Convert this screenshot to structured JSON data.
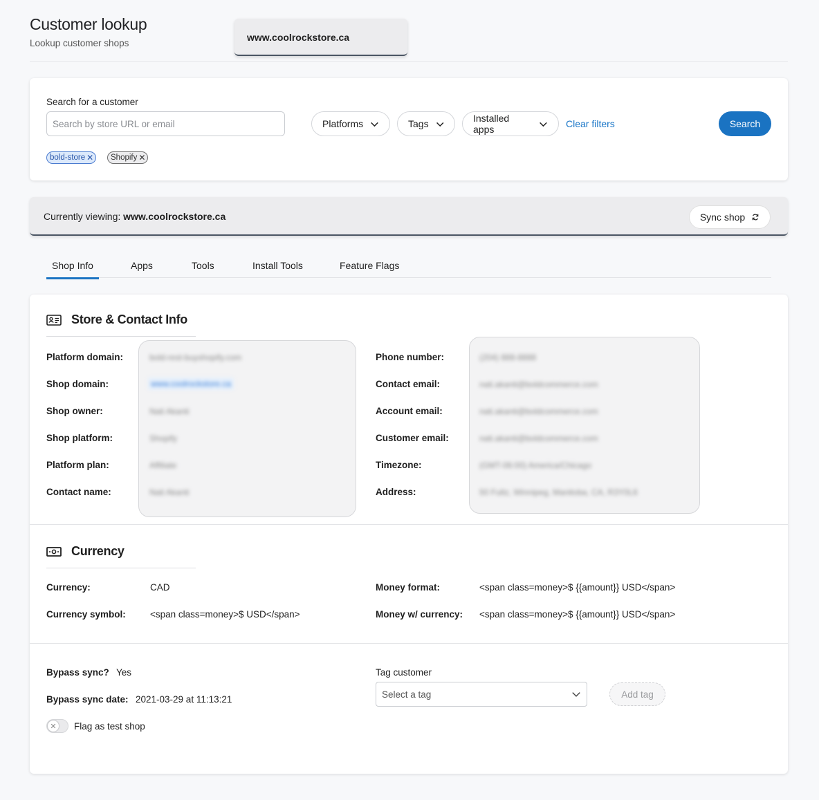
{
  "header": {
    "title": "Customer lookup",
    "subtitle": "Lookup customer shops",
    "current_shop": "www.coolrockstore.ca"
  },
  "search": {
    "label": "Search for a customer",
    "placeholder": "Search by store URL or email",
    "filters": [
      "Platforms",
      "Tags",
      "Installed apps"
    ],
    "clear_filters": "Clear filters",
    "search_button": "Search",
    "active_tags": [
      "bold-store",
      "Shopify"
    ]
  },
  "viewing": {
    "prefix": "Currently viewing:",
    "shop": "www.coolrockstore.ca",
    "sync_button": "Sync shop"
  },
  "tabs": [
    "Shop Info",
    "Apps",
    "Tools",
    "Install Tools",
    "Feature Flags"
  ],
  "store_contact": {
    "title": "Store & Contact Info",
    "left_labels": [
      "Platform domain:",
      "Shop domain:",
      "Shop owner:",
      "Shop platform:",
      "Platform plan:",
      "Contact name:"
    ],
    "left_values": [
      "bold-rest-buyshopify.com",
      "www.coolrockstore.ca",
      "Nati Akanti",
      "Shopify",
      "Affiliate",
      "Nati Akanti"
    ],
    "right_labels": [
      "Phone number:",
      "Contact email:",
      "Account email:",
      "Customer email:",
      "Timezone:",
      "Address:"
    ],
    "right_values": [
      "(204) 888-8888",
      "nati.akanti@boldcommerce.com",
      "nati.akanti@boldcommerce.com",
      "nati.akanti@boldcommerce.com",
      "(GMT-06:00) America/Chicago",
      "50 Fultz, Winnipeg, Manitoba, CA, R3Y0L6"
    ]
  },
  "currency": {
    "title": "Currency",
    "currency_label": "Currency:",
    "currency_value": "CAD",
    "symbol_label": "Currency symbol:",
    "symbol_value": "<span class=money>$ USD</span>",
    "money_format_label": "Money format:",
    "money_format_value": "<span class=money>$ {{amount}} USD</span>",
    "money_currency_label": "Money w/ currency:",
    "money_currency_value": "<span class=money>$ {{amount}} USD</span>"
  },
  "sync": {
    "bypass_label": "Bypass sync?",
    "bypass_value": "Yes",
    "bypass_date_label": "Bypass sync date:",
    "bypass_date_value": "2021-03-29 at 11:13:21",
    "test_shop_label": "Flag as test shop",
    "tag_customer_label": "Tag customer",
    "select_placeholder": "Select a tag",
    "add_tag_button": "Add tag"
  }
}
